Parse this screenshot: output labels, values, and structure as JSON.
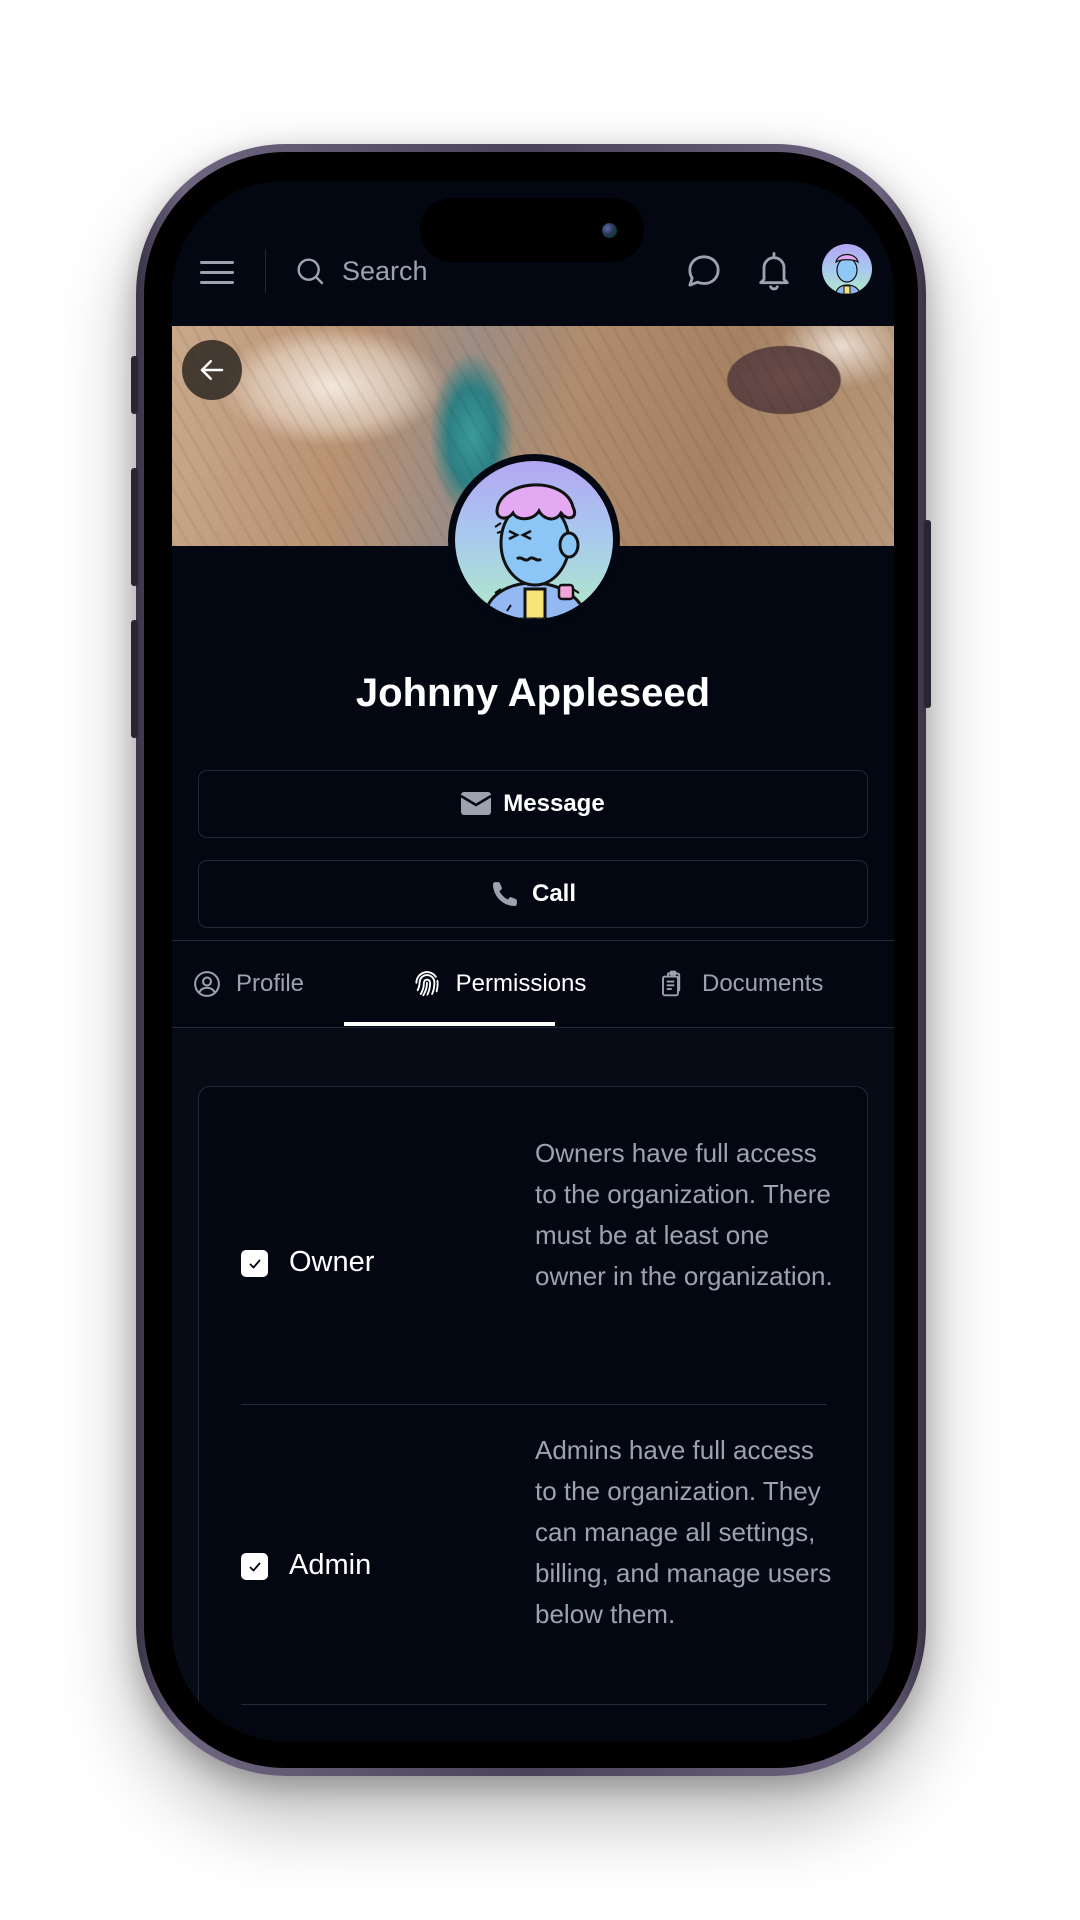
{
  "header": {
    "search_placeholder": "Search",
    "icons": [
      "menu-icon",
      "search-icon",
      "chat-bubble-icon",
      "bell-icon",
      "user-avatar"
    ]
  },
  "profile": {
    "name": "Johnny Appleseed",
    "back_icon": "arrow-left-icon"
  },
  "actions": {
    "message_label": "Message",
    "call_label": "Call"
  },
  "tabs": [
    {
      "label": "Profile",
      "icon": "user-circle-icon",
      "active": false
    },
    {
      "label": "Permissions",
      "icon": "fingerprint-icon",
      "active": true
    },
    {
      "label": "Documents",
      "icon": "clipboard-icon",
      "active": false
    }
  ],
  "permissions": [
    {
      "label": "Owner",
      "checked": true,
      "description": "Owners have full access to the organization. There must be at least one owner in the organization."
    },
    {
      "label": "Admin",
      "checked": true,
      "description": "Admins have full access to the organization. They can manage all settings, billing, and manage users below them."
    }
  ],
  "colors": {
    "background": "#030712",
    "border": "#1f2937",
    "muted_text": "#9ca3af",
    "text": "#ffffff"
  }
}
